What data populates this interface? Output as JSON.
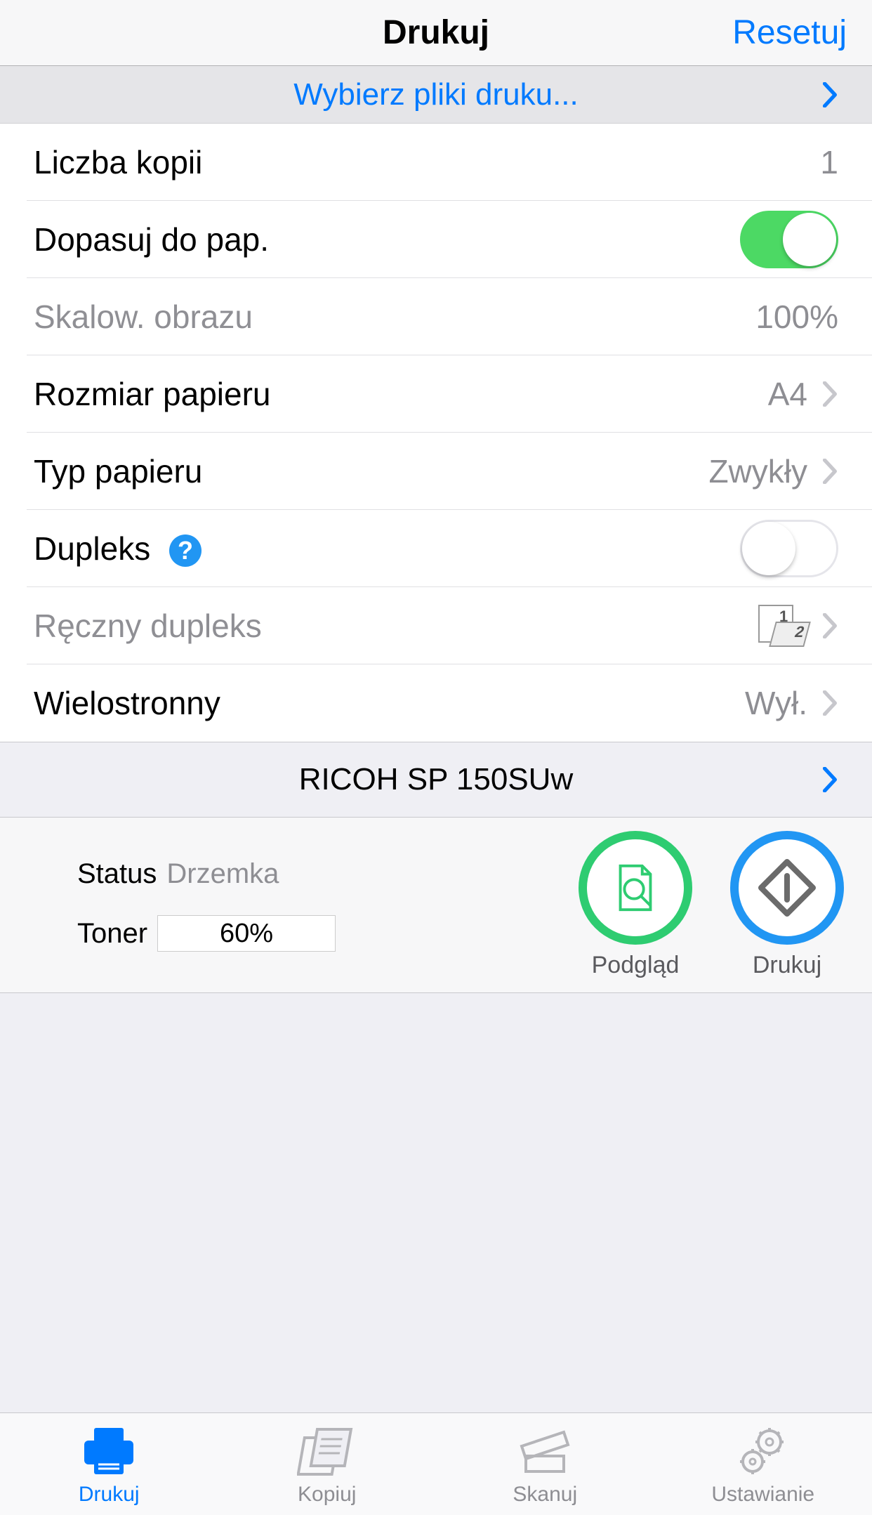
{
  "header": {
    "title": "Drukuj",
    "reset": "Resetuj"
  },
  "selectFiles": {
    "label": "Wybierz pliki druku..."
  },
  "settings": {
    "copies": {
      "label": "Liczba kopii",
      "value": "1"
    },
    "fitToPaper": {
      "label": "Dopasuj do pap.",
      "on": true
    },
    "imageScale": {
      "label": "Skalow. obrazu",
      "value": "100%"
    },
    "paperSize": {
      "label": "Rozmiar papieru",
      "value": "A4"
    },
    "paperType": {
      "label": "Typ papieru",
      "value": "Zwykły"
    },
    "duplex": {
      "label": "Dupleks",
      "on": false
    },
    "manualDuplex": {
      "label": "Ręczny dupleks"
    },
    "multipage": {
      "label": "Wielostronny",
      "value": "Wył."
    }
  },
  "printer": {
    "name": "RICOH SP 150SUw"
  },
  "status": {
    "label": "Status",
    "value": "Drzemka",
    "tonerLabel": "Toner",
    "tonerPercent": "60%",
    "tonerFill": 60
  },
  "actions": {
    "preview": "Podgląd",
    "print": "Drukuj"
  },
  "tabs": {
    "print": "Drukuj",
    "copy": "Kopiuj",
    "scan": "Skanuj",
    "settings": "Ustawianie"
  }
}
